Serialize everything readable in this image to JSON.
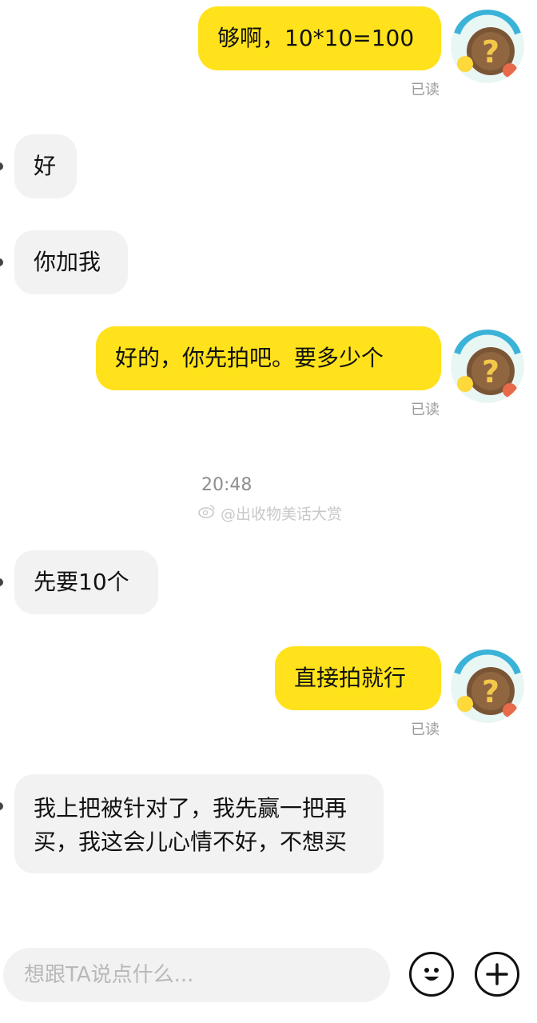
{
  "messages": [
    {
      "side": "mine",
      "text": "够啊，10*10=100",
      "status": "已读"
    },
    {
      "side": "theirs",
      "text": "好"
    },
    {
      "side": "theirs",
      "text": "你加我"
    },
    {
      "side": "mine",
      "text": "好的，你先拍吧。要多少个",
      "status": "已读"
    },
    {
      "side": "theirs",
      "text": "先要10个"
    },
    {
      "side": "mine",
      "text": "直接拍就行",
      "status": "已读"
    },
    {
      "side": "theirs",
      "text": "我上把被针对了，我先赢一把再买，我这会儿心情不好，不想买"
    }
  ],
  "timestamp": "20:48",
  "watermark": "@出收物美话大赏",
  "input": {
    "placeholder": "想跟TA说点什么..."
  },
  "icons": {
    "emoji": "smiley-face-icon",
    "add": "plus-icon",
    "avatar": "mystery-box-avatar"
  },
  "colors": {
    "my_bubble": "#ffe21b",
    "their_bubble": "#f2f2f2",
    "read_status": "#9a9a9a"
  }
}
